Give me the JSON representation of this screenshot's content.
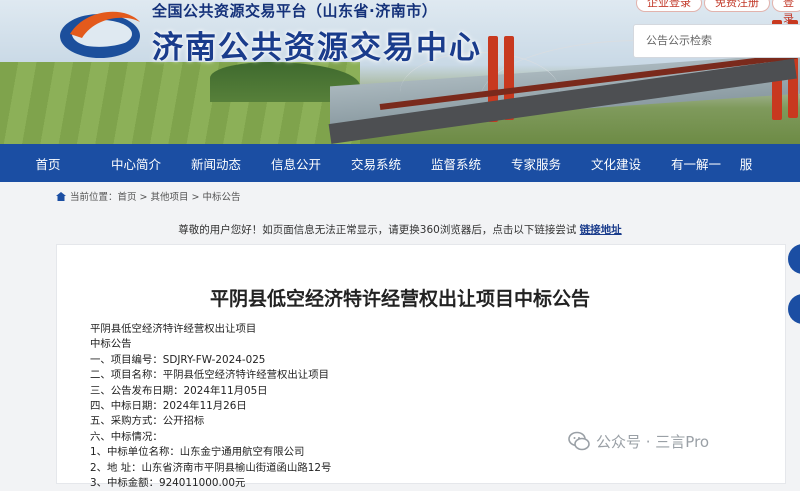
{
  "header": {
    "platform_name": "全国公共资源交易平台（山东省·济南市）",
    "site_title": "济南公共资源交易中心",
    "login_button": "企业登录",
    "register_button": "免费注册",
    "extra_button": "登录",
    "search_placeholder": "公告公示检索"
  },
  "nav": {
    "items": [
      "首页",
      "中心简介",
      "新闻动态",
      "信息公开",
      "交易系统",
      "监督系统",
      "专家服务",
      "文化建设",
      "有一解一",
      "服"
    ]
  },
  "breadcrumb": {
    "prefix": "当前位置：",
    "path": "首页 > 其他项目 > 中标公告"
  },
  "notice": {
    "text": "尊敬的用户您好！如页面信息无法正常显示，请更换360浏览器后，点击以下链接尝试 ",
    "link": "链接地址"
  },
  "document": {
    "title": "平阴县低空经济特许经营权出让项目中标公告",
    "lines": [
      "平阴县低空经济特许经营权出让项目",
      "中标公告",
      "一、项目编号：SDJRY-FW-2024-025",
      "二、项目名称：平阴县低空经济特许经营权出让项目",
      "三、公告发布日期：2024年11月05日",
      "四、中标日期：2024年11月26日",
      "五、采购方式：公开招标",
      "六、中标情况：",
      "1、中标单位名称：山东金宁通用航空有限公司",
      "2、地  址：山东省济南市平阴县榆山街道函山路12号",
      "3、中标金额：924011000.00元"
    ]
  },
  "watermark": {
    "text": "公众号 · 三言Pro"
  },
  "colors": {
    "nav_bg": "#1b4ea3",
    "title_blue": "#1a3c8c",
    "accent_red": "#c23a2a"
  }
}
